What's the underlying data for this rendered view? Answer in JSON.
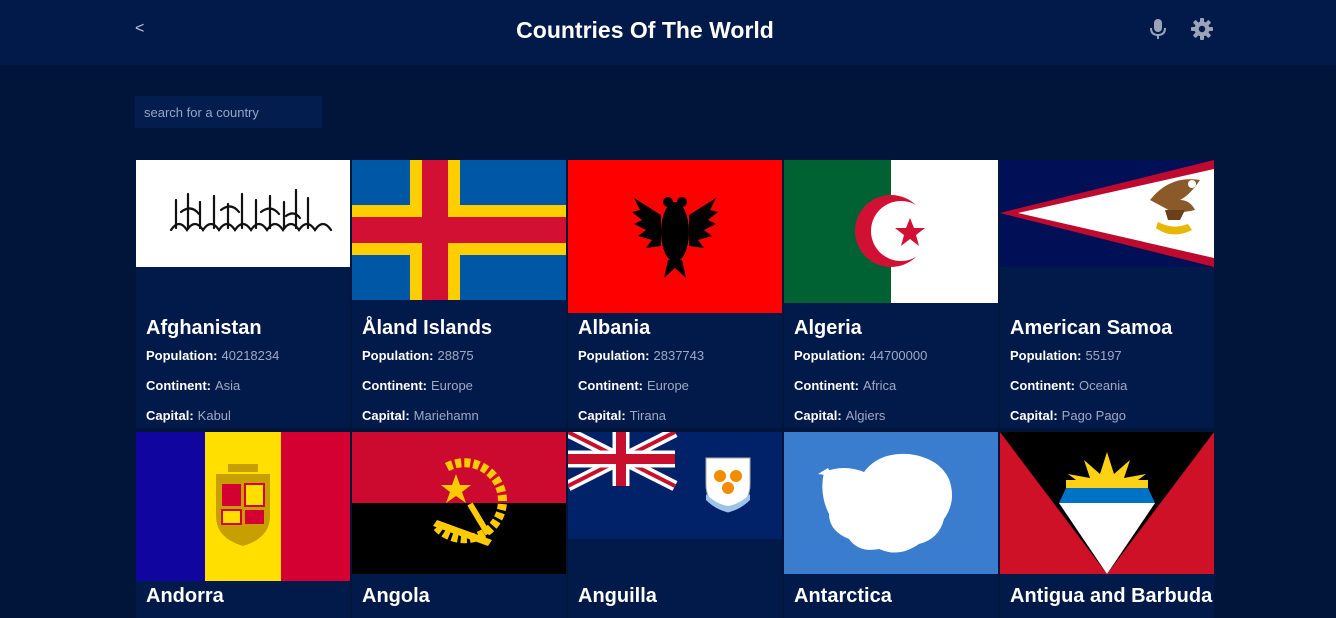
{
  "header": {
    "back_label": "<",
    "title": "Countries Of The World",
    "mic_icon": "microphone-icon",
    "settings_icon": "gear-icon"
  },
  "search": {
    "placeholder": "search for a country",
    "value": ""
  },
  "labels": {
    "population": "Population:",
    "continent": "Continent:",
    "capital": "Capital:"
  },
  "countries": [
    {
      "name": "Afghanistan",
      "population": "40218234",
      "continent": "Asia",
      "capital": "Kabul",
      "flag": "afghanistan-flag"
    },
    {
      "name": "Åland Islands",
      "population": "28875",
      "continent": "Europe",
      "capital": "Mariehamn",
      "flag": "aland-flag"
    },
    {
      "name": "Albania",
      "population": "2837743",
      "continent": "Europe",
      "capital": "Tirana",
      "flag": "albania-flag"
    },
    {
      "name": "Algeria",
      "population": "44700000",
      "continent": "Africa",
      "capital": "Algiers",
      "flag": "algeria-flag"
    },
    {
      "name": "American Samoa",
      "population": "55197",
      "continent": "Oceania",
      "capital": "Pago Pago",
      "flag": "american-samoa-flag"
    },
    {
      "name": "Andorra",
      "flag": "andorra-flag"
    },
    {
      "name": "Angola",
      "flag": "angola-flag"
    },
    {
      "name": "Anguilla",
      "flag": "anguilla-flag"
    },
    {
      "name": "Antarctica",
      "flag": "antarctica-flag"
    },
    {
      "name": "Antigua and Barbuda",
      "flag": "antigua-and-barbuda-flag"
    }
  ],
  "colors": {
    "background": "#01153a",
    "header": "#021a4a",
    "card": "#021a4a",
    "value_text": "#9fa9c0"
  }
}
